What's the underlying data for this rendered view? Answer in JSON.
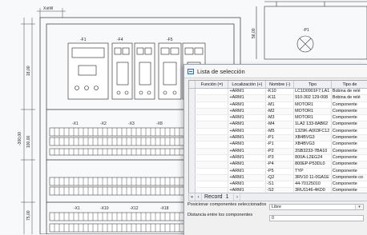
{
  "drawing": {
    "sheet_ref": "X⊘W",
    "dim_left_top": "18,00",
    "dim_left_mid": "-300,00",
    "dim_left_low": "100,00",
    "dim_left_bottom": "75,00",
    "dim_right": "56,00",
    "fuse_labels": [
      "-F1",
      "-F4",
      "-F5"
    ],
    "terminal_labels": [
      "-X1",
      "-X2",
      "-X3",
      "-X8"
    ],
    "lower_labels": [
      "-X1",
      "-X10",
      "-X12",
      "-X18"
    ],
    "right_label": "-P1"
  },
  "dialog": {
    "title": "Lista de selección",
    "columns": [
      "Función (=)",
      "Localización (+)",
      "Nombre (-)",
      "Tipo",
      "Tipo de"
    ],
    "rows": [
      [
        "+ARM1",
        "-K10",
        "LC1D0901F7;LA1",
        "Bobina de relé"
      ],
      [
        "+ARM1",
        "-K11",
        "910-302 129-008",
        "Bobina de relé"
      ],
      [
        "+ARM1",
        "-M1",
        "MOTOR1",
        "Componente"
      ],
      [
        "+ARM1",
        "-M2",
        "MOTOR1",
        "Componente"
      ],
      [
        "+ARM1",
        "-M3",
        "MOTOR1",
        "Componente"
      ],
      [
        "+ARM1",
        "-M4",
        "1LA2 133-8AB62",
        "Componente"
      ],
      [
        "+ARM1",
        "-M5",
        "1329K-A003FC12",
        "Componente"
      ],
      [
        "+ARM1",
        "-P1",
        "XB4BVG3",
        "Componente"
      ],
      [
        "+ARM1",
        "-P1",
        "XB4BVG3",
        "Componente"
      ],
      [
        "+ARM1",
        "-P2",
        "3SB3233-7BA10",
        "Componente"
      ],
      [
        "+ARM1",
        "-P3",
        "800A-L2EG24",
        "Componente"
      ],
      [
        "+ARM1",
        "-P4",
        "800EP-P53DL0",
        "Componente"
      ],
      [
        "+ARM1",
        "-P5",
        "TYP",
        "Componente"
      ],
      [
        "+ARM1",
        "-Q2",
        "3RV10 11-0GA1E",
        "Componente co"
      ],
      [
        "+ARM1",
        "-S1",
        "44-70125010",
        "Componente"
      ],
      [
        "+ARM1",
        "-S2",
        "3RU1146-4KD0",
        "Componente"
      ],
      [
        "+ARM1",
        "-S3",
        "193-TCC75",
        "Componente"
      ],
      [
        "+ARM1",
        "-S4",
        "XB4BA42",
        "Componente"
      ]
    ],
    "nav": {
      "label": "Record",
      "current": "1"
    },
    "position_label": "Posicionar componentes seleccionados",
    "position_value": "Libre",
    "distance_label": "Distancia entre los componentes",
    "distance_value": "0"
  }
}
